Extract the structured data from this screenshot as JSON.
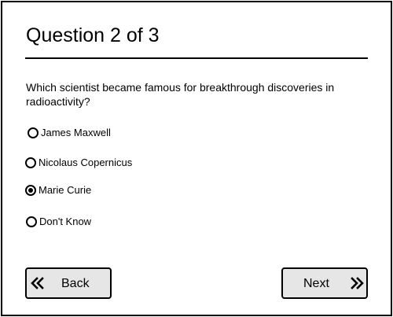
{
  "quiz": {
    "title": "Question 2 of 3",
    "question_text": "Which scientist became famous for breakthrough discoveries in radioactivity?",
    "options": [
      {
        "label": "James Maxwell",
        "selected": false
      },
      {
        "label": "Nicolaus Copernicus",
        "selected": false
      },
      {
        "label": "Marie Curie",
        "selected": true
      },
      {
        "label": "Don't Know",
        "selected": false
      }
    ]
  },
  "navigation": {
    "back_label": "Back",
    "back_icon": "double-chevron-left-icon",
    "next_label": "Next",
    "next_icon": "double-chevron-right-icon"
  },
  "colors": {
    "button_background": "#e6e6e6",
    "border": "#000000"
  }
}
